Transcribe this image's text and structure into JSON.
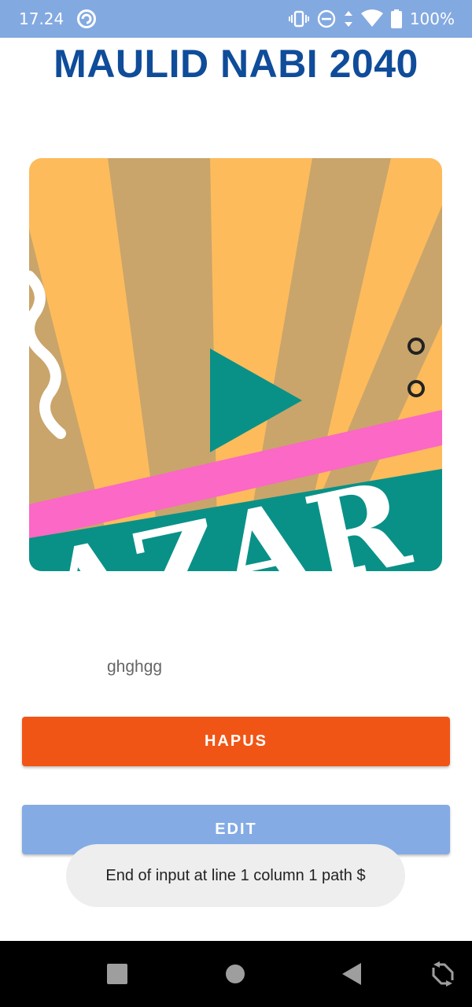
{
  "status_bar": {
    "time": "17.24",
    "battery": "100%",
    "icons": [
      "vibrate-icon",
      "do-not-disturb-icon",
      "data-arrows-icon",
      "wifi-icon",
      "battery-icon"
    ]
  },
  "page": {
    "title": "MAULID NABI 2040",
    "image_text": "AZAR",
    "caption": "ghghgg"
  },
  "buttons": {
    "delete_label": "HAPUS",
    "edit_label": "EDIT"
  },
  "toast": {
    "message": "End of input at line 1 column 1 path $"
  },
  "colors": {
    "status_bar": "#83a9e1",
    "title": "#0f4c9a",
    "delete_button": "#f15515",
    "edit_button": "#84abe4"
  },
  "nav_bar": {
    "icons": [
      "recents-icon",
      "home-icon",
      "back-icon",
      "rotate-icon"
    ]
  }
}
